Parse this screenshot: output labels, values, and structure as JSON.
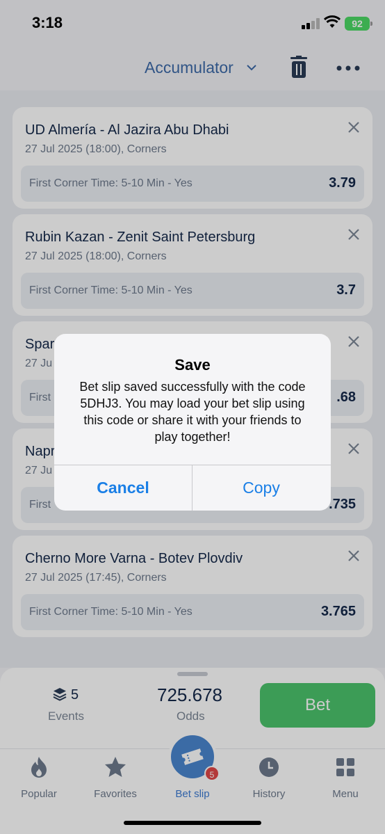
{
  "status": {
    "time": "3:18",
    "battery": "92"
  },
  "header": {
    "title": "Accumulator"
  },
  "bets": [
    {
      "match": "UD Almería - Al Jazira Abu Dhabi",
      "meta": "27 Jul 2025 (18:00), Corners",
      "selection": "First Corner Time: 5-10 Min - Yes",
      "odds": "3.79"
    },
    {
      "match": "Rubin Kazan - Zenit Saint Petersburg",
      "meta": "27 Jul 2025 (18:00), Corners",
      "selection": "First Corner Time: 5-10 Min - Yes",
      "odds": "3.7"
    },
    {
      "match": "Spar",
      "meta": "27 Ju",
      "selection": "First",
      "odds": ".68"
    },
    {
      "match": "Napr",
      "meta": "27 Ju",
      "selection": "First",
      "odds": ".735"
    },
    {
      "match": "Cherno More Varna - Botev Plovdiv",
      "meta": "27 Jul 2025 (17:45), Corners",
      "selection": "First Corner Time: 5-10 Min - Yes",
      "odds": "3.765"
    }
  ],
  "summary": {
    "events_count": "5",
    "events_label": "Events",
    "odds_value": "725.678",
    "odds_label": "Odds",
    "bet_label": "Bet"
  },
  "tabs": {
    "popular": "Popular",
    "favorites": "Favorites",
    "betslip": "Bet slip",
    "history": "History",
    "menu": "Menu",
    "badge": "5"
  },
  "dialog": {
    "title": "Save",
    "message": "Bet slip saved successfully with the code 5DHJ3. You may load your bet slip using this code or share it with your friends to play together!",
    "cancel": "Cancel",
    "copy": "Copy"
  },
  "colors": {
    "accent": "#3d7bd2",
    "bet_green": "#4cc36c",
    "badge_red": "#e04848"
  }
}
